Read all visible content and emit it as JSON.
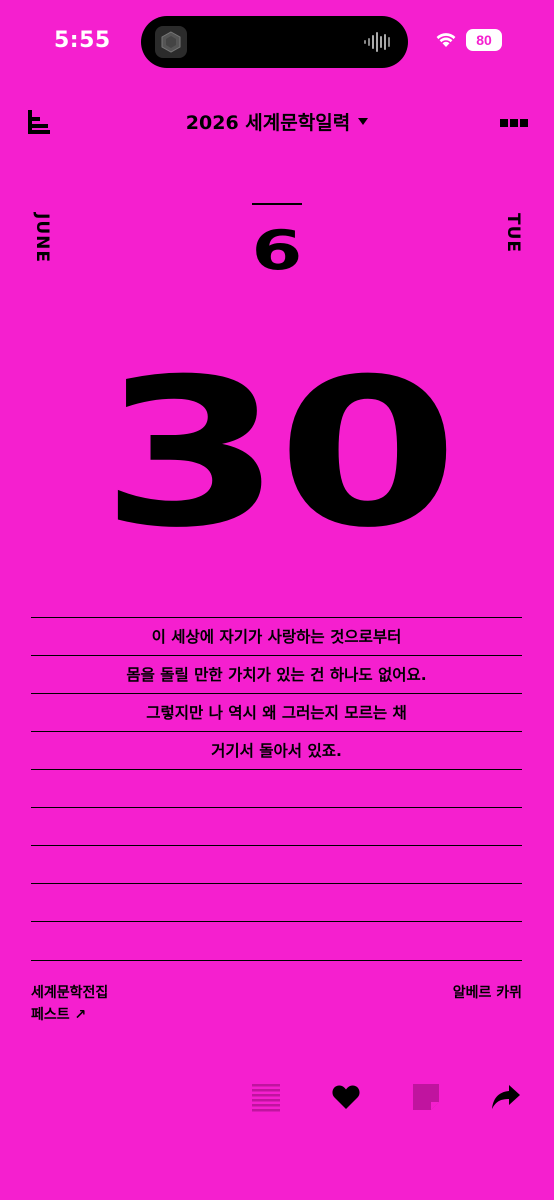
{
  "status_bar": {
    "time": "5:55",
    "battery": "80"
  },
  "header": {
    "calendar_title": "2026 세계문학일력"
  },
  "date": {
    "month_name": "JUNE",
    "weekday": "TUE",
    "month_number": "6",
    "day_number": "30"
  },
  "quote": {
    "lines": [
      "이 세상에 자기가 사랑하는 것으로부터",
      "몸을 돌릴 만한 가치가 있는 건 하나도 없어요.",
      "그렇지만 나 역시 왜 그러는지 모르는 채",
      "거기서 돌아서 있죠.",
      "",
      "",
      "",
      "",
      ""
    ]
  },
  "source": {
    "collection": "세계문학전집",
    "book": "페스트 ↗",
    "author": "알베르 카뮈"
  },
  "colors": {
    "background": "#f51fcf",
    "text": "#000000",
    "muted_icon": "#c0149f"
  },
  "toolbar": {
    "icons": [
      "lines-icon",
      "heart-icon",
      "note-icon",
      "share-icon"
    ]
  }
}
